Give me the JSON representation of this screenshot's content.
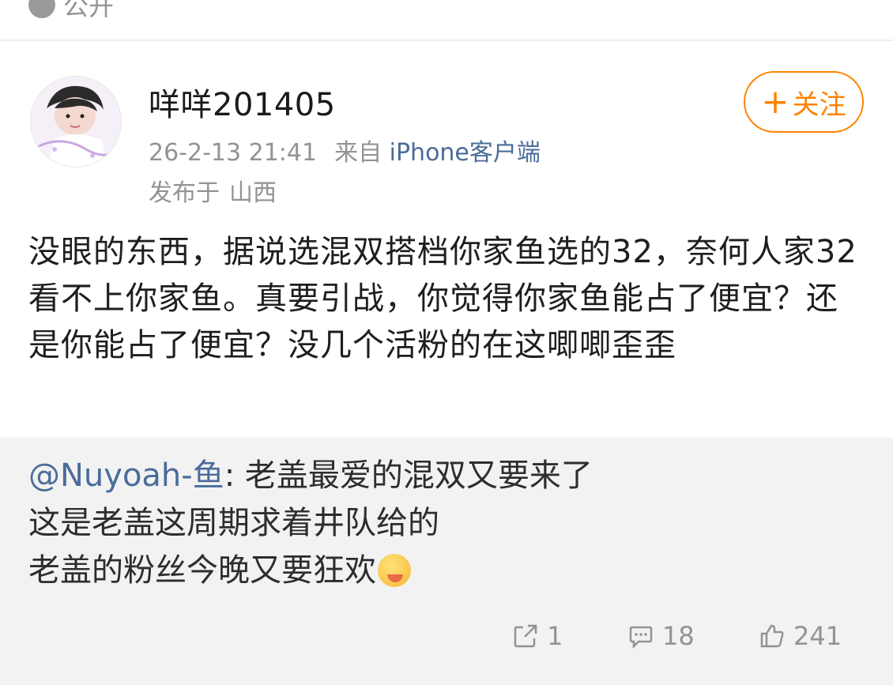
{
  "top": {
    "visibility_label": "公开"
  },
  "post": {
    "username": "咩咩201405",
    "timestamp": "26-2-13 21:41",
    "source_prefix": "来自",
    "source": "iPhone客户端",
    "location_prefix": "发布于",
    "location": "山西",
    "follow_label": "关注",
    "follow_plus": "+",
    "text": "没眼的东西，据说选混双搭档你家鱼选的32，奈何人家32看不上你家鱼。真要引战，你觉得你家鱼能占了便宜？还是你能占了便宜？没几个活粉的在这唧唧歪歪"
  },
  "repost": {
    "mention": "@Nuyoah-鱼",
    "line1": ": 老盖最爱的混双又要来了",
    "line2": "这是老盖这周期求着井队给的",
    "line3": "老盖的粉丝今晚又要狂欢",
    "emoji_icon": "yum-face-emoji"
  },
  "actions": {
    "repost_count": "1",
    "comment_count": "18",
    "like_count": "241"
  },
  "colors": {
    "accent_orange": "#ff8200",
    "link_blue": "#4a6c9a",
    "meta_gray": "#939393",
    "repost_bg": "#f2f2f2"
  }
}
